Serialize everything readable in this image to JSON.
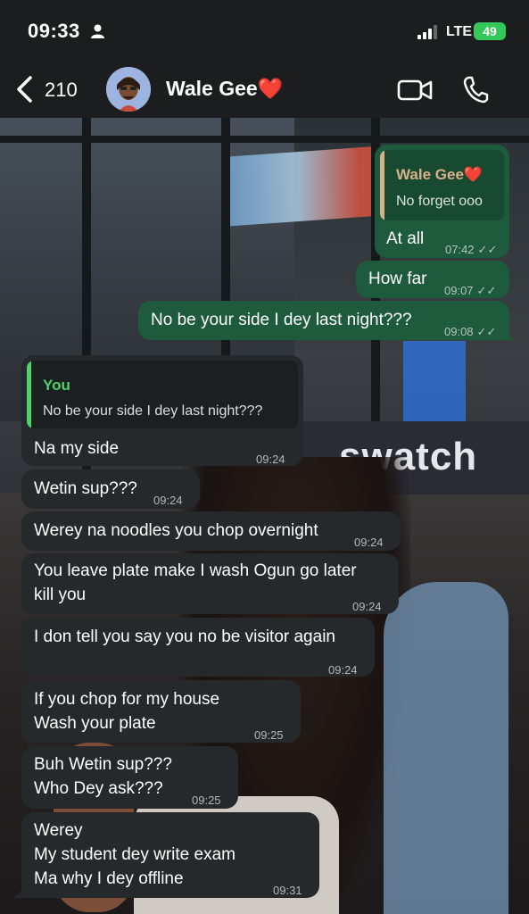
{
  "status_bar": {
    "time": "09:33",
    "network": "LTE",
    "battery": "49"
  },
  "header": {
    "back_count": "210",
    "contact_name": "Wale Gee❤️"
  },
  "messages": [
    {
      "direction": "outgoing",
      "quote": {
        "author": "Wale Gee❤️",
        "text": "No forget ooo"
      },
      "text": "At all",
      "time": "07:42",
      "ticks": "✓✓"
    },
    {
      "direction": "outgoing",
      "text": "How far",
      "time": "09:07",
      "ticks": "✓✓"
    },
    {
      "direction": "outgoing",
      "text": "No be your side I dey last night???",
      "time": "09:08",
      "ticks": "✓✓"
    },
    {
      "direction": "incoming",
      "quote": {
        "author": "You",
        "text": "No be your side I dey last night???"
      },
      "text": "Na my side",
      "time": "09:24"
    },
    {
      "direction": "incoming",
      "text": "Wetin sup???",
      "time": "09:24"
    },
    {
      "direction": "incoming",
      "text": "Werey na noodles you chop overnight",
      "time": "09:24"
    },
    {
      "direction": "incoming",
      "text": "You leave plate make I wash Ogun go later\nkill you",
      "time": "09:24"
    },
    {
      "direction": "incoming",
      "text": "I don tell you say you no be visitor again",
      "time": "09:24"
    },
    {
      "direction": "incoming",
      "text": "If you chop for my house\nWash your plate",
      "time": "09:25"
    },
    {
      "direction": "incoming",
      "text": "Buh Wetin sup???\nWho Dey ask???",
      "time": "09:25"
    },
    {
      "direction": "incoming",
      "text": "Werey\nMy student dey write exam\nMa why I dey offline",
      "time": "09:31"
    }
  ],
  "wallpaper": {
    "sign_text": "swatch"
  },
  "colors": {
    "outgoing_bubble": "#1e5b3c",
    "incoming_bubble": "#25292b",
    "quote_you_accent": "#4fd16b",
    "quote_contact_accent": "#d9b089",
    "battery": "#34c759"
  }
}
